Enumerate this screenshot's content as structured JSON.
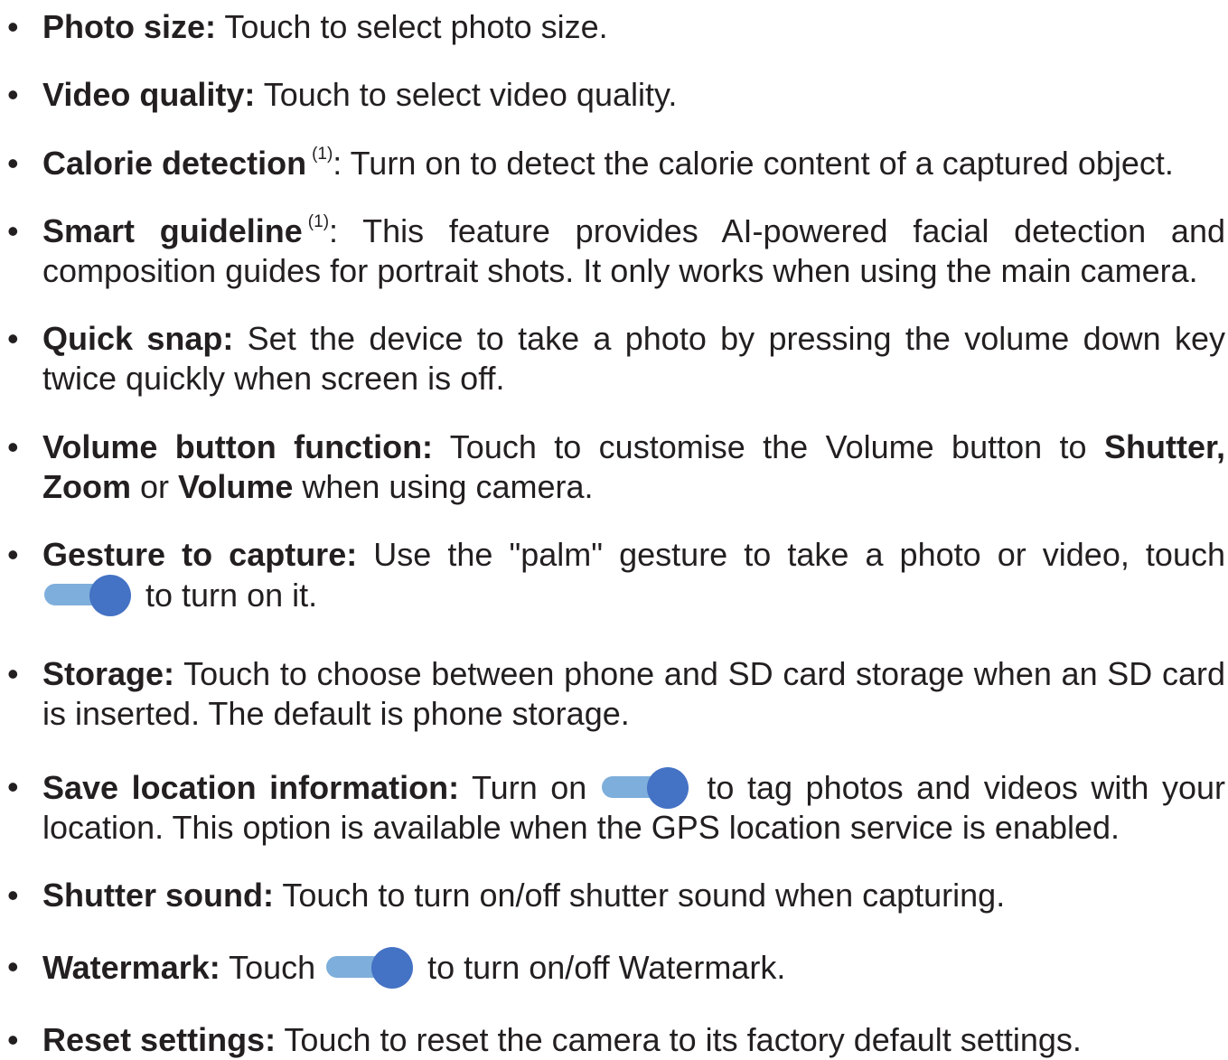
{
  "bullet_char": "•",
  "items": [
    {
      "term": "Photo size:",
      "rest": " Touch to select photo size."
    },
    {
      "term": "Video quality:",
      "rest": " Touch to select video quality."
    },
    {
      "term": "Calorie detection",
      "sup": "(1)",
      "rest": ": Turn on to detect the calorie content of a captured object."
    },
    {
      "term": "Smart guideline",
      "sup": "(1)",
      "rest": ": This feature provides AI-powered facial detection and composition guides for portrait shots. It only works when using the main camera."
    },
    {
      "term": "Quick snap:",
      "rest": " Set the device to take a photo by pressing the volume down key twice quickly when screen is off."
    },
    {
      "term": "Volume button function:",
      "rest_a": " Touch to customise the Volume button to ",
      "b1": "Shutter, Zoom",
      "mid": " or ",
      "b2": "Volume",
      "rest_b": " when using camera."
    },
    {
      "term": "Gesture to capture:",
      "rest_a": " Use the \"palm\" gesture to take a photo or video, touch ",
      "rest_b": " to turn on it."
    },
    {
      "term": "Storage:",
      "rest": " Touch to choose between phone and SD card storage when an SD card is inserted. The default is phone storage."
    },
    {
      "term": "Save location information:",
      "rest_a": " Turn on ",
      "rest_b": " to tag photos and videos with your location. This option is available when the GPS location service is enabled."
    },
    {
      "term": "Shutter sound:",
      "rest": " Touch to turn on/off shutter sound when capturing."
    },
    {
      "term": "Watermark:",
      "rest_a": " Touch ",
      "rest_b": " to turn on/off Watermark."
    },
    {
      "term": "Reset settings:",
      "rest": " Touch to reset the camera to its factory default settings."
    }
  ],
  "colors": {
    "text": "#231f20",
    "toggle_track": "#7eaedb",
    "toggle_knob": "#4472c4"
  },
  "icons": {
    "toggle": "toggle-switch-on-icon"
  }
}
